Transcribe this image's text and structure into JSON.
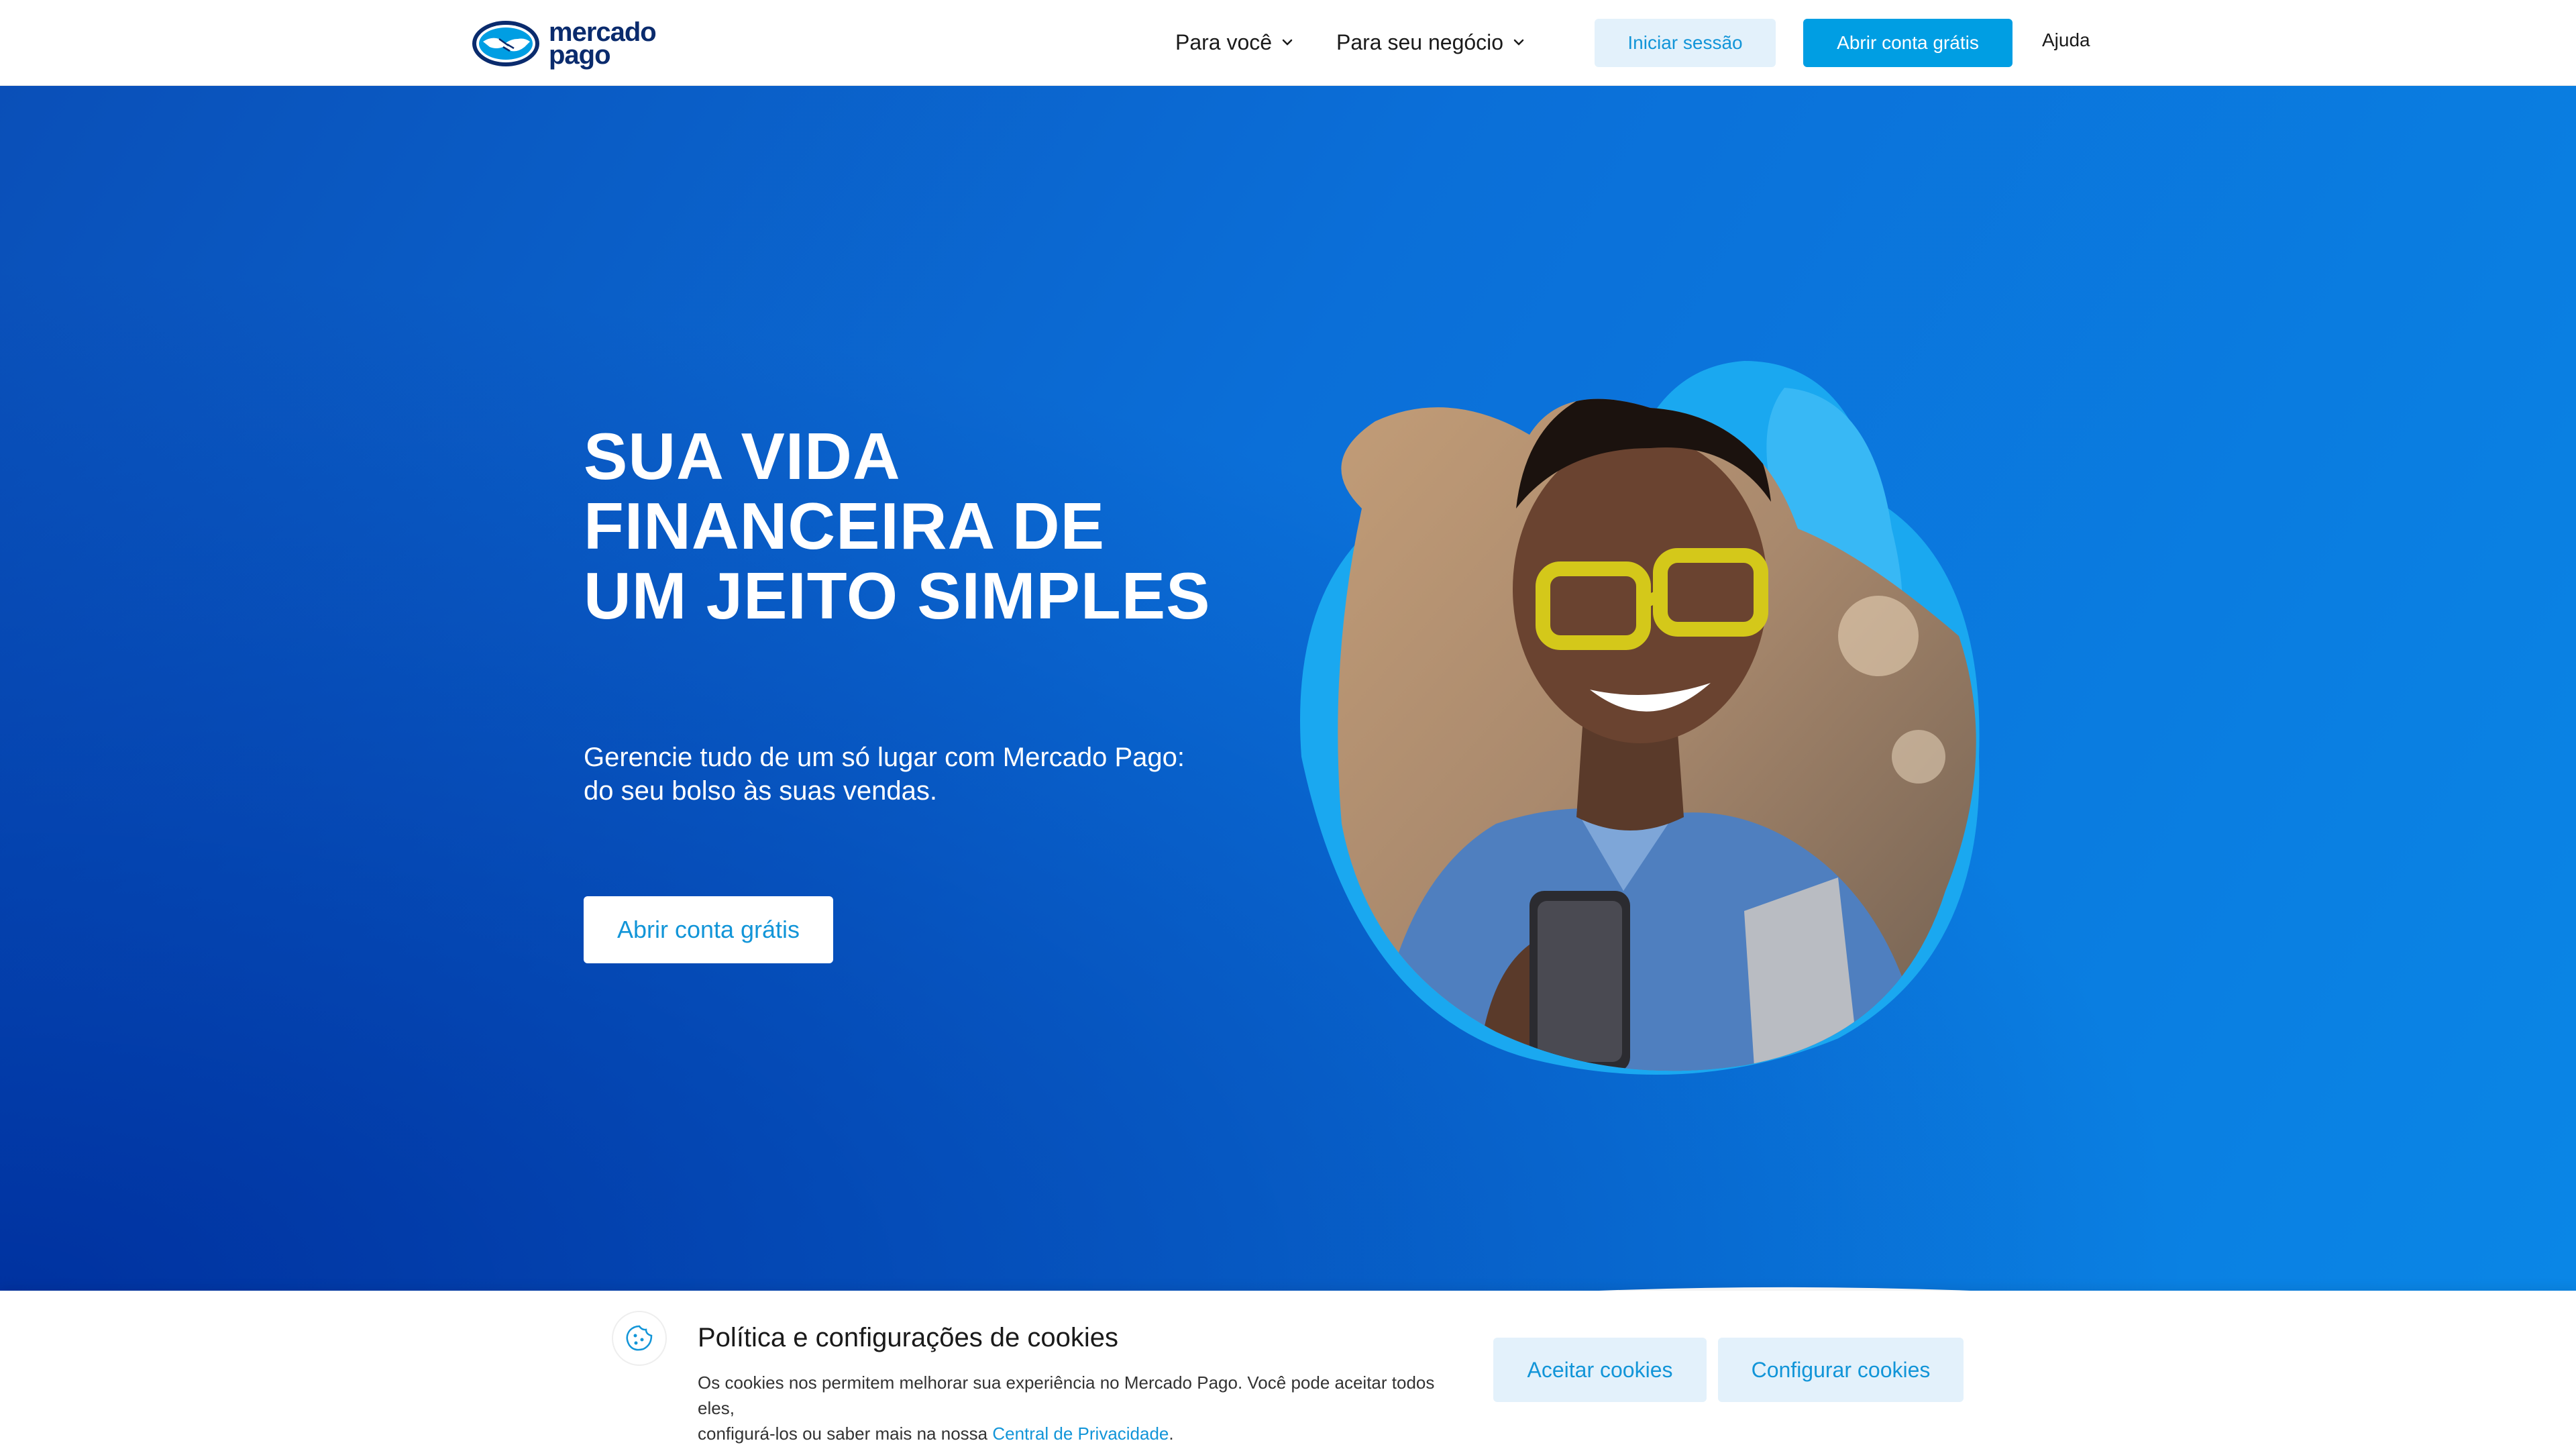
{
  "colors": {
    "brand_blue": "#009ee3",
    "brand_dark": "#0a2b6d",
    "hero_gradient_start": "#0a4fb8",
    "hero_gradient_end": "#0a86e6",
    "light_button_bg": "#e3f1fb",
    "link": "#1295d8"
  },
  "header": {
    "logo": {
      "line1": "mercado",
      "line2": "pago",
      "icon": "handshake-logo-icon"
    },
    "nav": [
      {
        "label": "Para você",
        "icon": "chevron-down-icon"
      },
      {
        "label": "Para seu negócio",
        "icon": "chevron-down-icon"
      }
    ],
    "login_label": "Iniciar sessão",
    "open_account_label": "Abrir conta grátis",
    "help_label": "Ajuda"
  },
  "hero": {
    "title_lines": [
      "SUA VIDA",
      "FINANCEIRA DE",
      "UM JEITO SIMPLES"
    ],
    "subtitle_lines": [
      "Gerencie tudo de um só lugar com Mercado Pago:",
      "do seu bolso às suas vendas."
    ],
    "cta_label": "Abrir conta grátis",
    "image": "woman-with-yellow-glasses-holding-phone"
  },
  "cookie_banner": {
    "icon": "cookie-icon",
    "title": "Política e configurações de cookies",
    "text_line1": "Os cookies nos permitem melhorar sua experiência no Mercado Pago. Você pode aceitar todos eles,",
    "text_line2_prefix": "configurá-los ou saber mais na nossa ",
    "link_label": "Central de Privacidade",
    "text_line2_suffix": ".",
    "accept_label": "Aceitar cookies",
    "configure_label": "Configurar cookies"
  }
}
